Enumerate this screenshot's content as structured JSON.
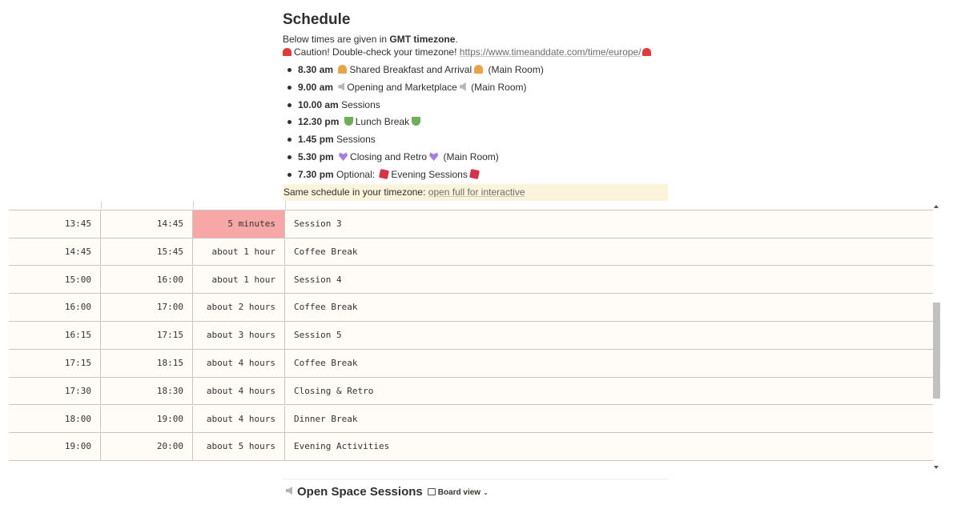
{
  "schedule": {
    "title": "Schedule",
    "intro_prefix": "Below times are given in ",
    "intro_bold": "GMT timezone",
    "intro_suffix": ".",
    "caution_text": "Caution! Double-check your timezone! ",
    "caution_link": "https://www.timeanddate.com/time/europe/",
    "items": [
      {
        "time": "8.30 am",
        "text": "Shared Breakfast and Arrival",
        "emoji": "croissant-icon",
        "suffix": "(Main Room)"
      },
      {
        "time": "9.00 am",
        "text": "Opening and Marketplace",
        "emoji": "speaker-icon",
        "suffix": "(Main Room)"
      },
      {
        "time": "10.00 am",
        "text": "Sessions",
        "emoji": "",
        "suffix": ""
      },
      {
        "time": "12.30 pm",
        "text": "Lunch Break",
        "emoji": "salad-icon",
        "suffix": ""
      },
      {
        "time": "1.45 pm",
        "text": "Sessions",
        "emoji": "",
        "suffix": ""
      },
      {
        "time": "5.30 pm",
        "text": "Closing and Retro",
        "emoji": "purple-heart-icon",
        "suffix": "(Main Room)"
      },
      {
        "time": "7.30 pm",
        "text": "Optional: ",
        "text2": "Evening Sessions",
        "emoji": "dice-icon",
        "suffix": ""
      }
    ],
    "callout_text": "Same schedule in your timezone: ",
    "callout_link": "open full for interactive"
  },
  "table": {
    "rows": [
      {
        "start": "13:45",
        "end": "14:45",
        "until": "5 minutes",
        "name": "Session 3",
        "highlight": true
      },
      {
        "start": "14:45",
        "end": "15:45",
        "until": "about 1 hour",
        "name": "Coffee Break",
        "highlight": false
      },
      {
        "start": "15:00",
        "end": "16:00",
        "until": "about 1 hour",
        "name": "Session 4",
        "highlight": false
      },
      {
        "start": "16:00",
        "end": "17:00",
        "until": "about 2 hours",
        "name": "Coffee Break",
        "highlight": false
      },
      {
        "start": "16:15",
        "end": "17:15",
        "until": "about 3 hours",
        "name": "Session 5",
        "highlight": false
      },
      {
        "start": "17:15",
        "end": "18:15",
        "until": "about 4 hours",
        "name": "Coffee Break",
        "highlight": false
      },
      {
        "start": "17:30",
        "end": "18:30",
        "until": "about 4 hours",
        "name": "Closing & Retro",
        "highlight": false
      },
      {
        "start": "18:00",
        "end": "19:00",
        "until": "about 4 hours",
        "name": "Dinner Break",
        "highlight": false
      },
      {
        "start": "19:00",
        "end": "20:00",
        "until": "about 5 hours",
        "name": "Evening Activities",
        "highlight": false
      }
    ],
    "highlight_color": "#f8a7a7"
  },
  "board": {
    "title": "Open Space Sessions",
    "view_label": "Board view"
  }
}
